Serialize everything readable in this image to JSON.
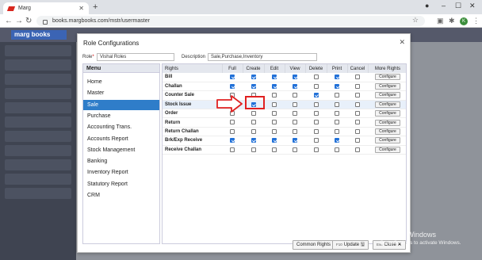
{
  "browser": {
    "tab_title": "Marg",
    "url": "books.margbooks.com/mstr/usermaster",
    "avatar_letter": "K"
  },
  "app": {
    "logo_text": "marg books"
  },
  "modal": {
    "title": "Role Configurations",
    "role_label": "Role",
    "role_value": "Vishal Roles",
    "description_label": "Description",
    "description_value": "Sale,Purchase,Inventory"
  },
  "menu": {
    "header": "Menu",
    "items": [
      {
        "label": "Home",
        "active": false
      },
      {
        "label": "Master",
        "active": false
      },
      {
        "label": "Sale",
        "active": true
      },
      {
        "label": "Purchase",
        "active": false
      },
      {
        "label": "Accounting Trans.",
        "active": false
      },
      {
        "label": "Accounts Report",
        "active": false
      },
      {
        "label": "Stock Management",
        "active": false
      },
      {
        "label": "Banking",
        "active": false
      },
      {
        "label": "Inventory Report",
        "active": false
      },
      {
        "label": "Statutory Report",
        "active": false
      },
      {
        "label": "CRM",
        "active": false
      }
    ]
  },
  "rights_table": {
    "columns": [
      "Rights",
      "Full",
      "Create",
      "Edit",
      "View",
      "Delete",
      "Print",
      "Cancel",
      "More Rights"
    ],
    "configure_label": "Configure",
    "rows": [
      {
        "name": "Bill",
        "checks": [
          true,
          true,
          true,
          true,
          false,
          true,
          false
        ]
      },
      {
        "name": "Challan",
        "checks": [
          true,
          true,
          true,
          true,
          false,
          true,
          false
        ]
      },
      {
        "name": "Counter Sale",
        "checks": [
          false,
          false,
          false,
          false,
          true,
          false,
          false
        ]
      },
      {
        "name": "Stock Issue",
        "checks": [
          false,
          true,
          false,
          false,
          false,
          false,
          false
        ]
      },
      {
        "name": "Order",
        "checks": [
          false,
          false,
          false,
          false,
          false,
          false,
          false
        ]
      },
      {
        "name": "Return",
        "checks": [
          false,
          false,
          false,
          false,
          false,
          false,
          false
        ]
      },
      {
        "name": "Return Challan",
        "checks": [
          false,
          false,
          false,
          false,
          false,
          false,
          false
        ]
      },
      {
        "name": "Brk/Exp Receive",
        "checks": [
          true,
          true,
          true,
          true,
          false,
          true,
          false
        ]
      },
      {
        "name": "Receive Challan",
        "checks": [
          false,
          false,
          false,
          false,
          false,
          false,
          false
        ]
      }
    ]
  },
  "footer": {
    "common_rights": "Common Rights",
    "update_key": "F10",
    "update_label": "Update",
    "close_key": "Esc",
    "close_label": "Close"
  },
  "watermark": {
    "line1": "Activate Windows",
    "line2": "Go to Settings to activate Windows."
  }
}
